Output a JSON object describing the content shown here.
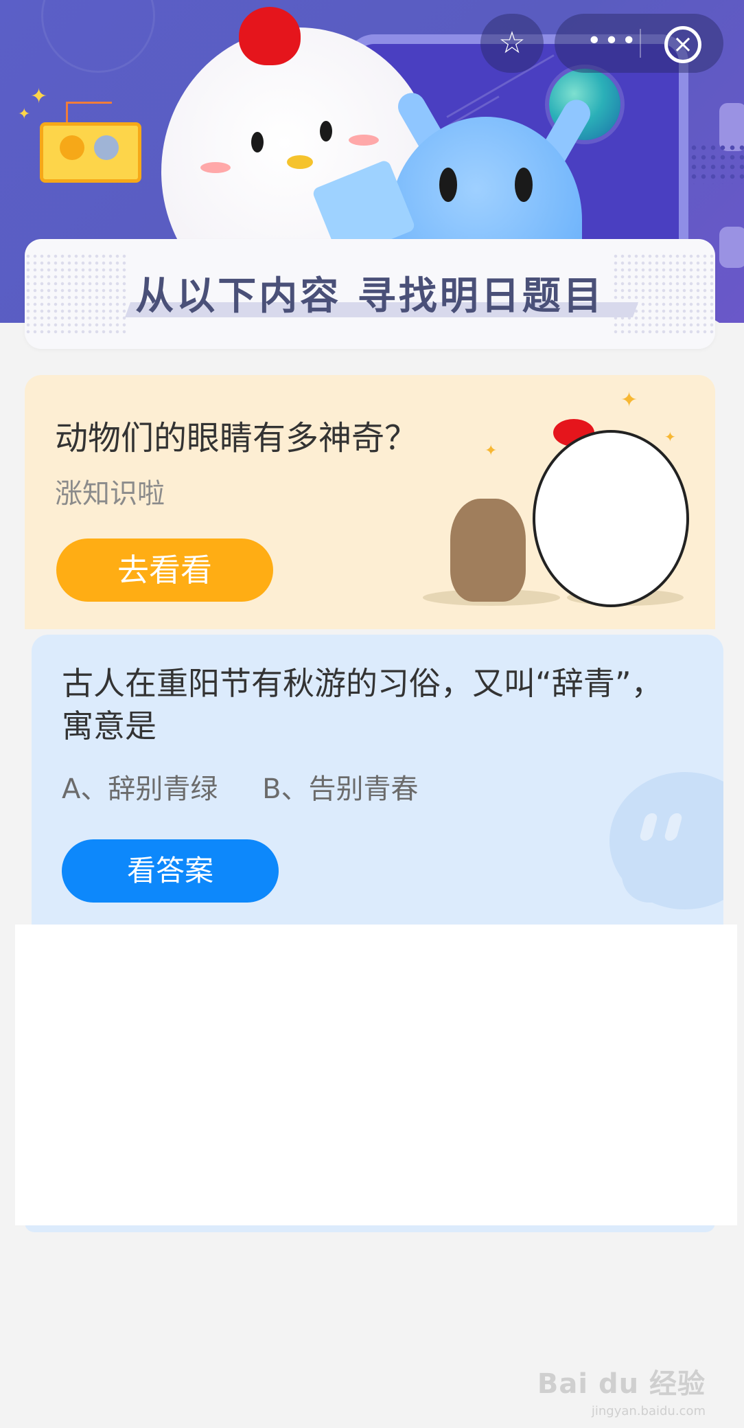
{
  "header": {
    "banner_title": "从以下内容  寻找明日题目",
    "icons": [
      "star-icon",
      "more-icon",
      "close-icon"
    ]
  },
  "article_card": {
    "title": "动物们的眼睛有多神奇？",
    "subtitle": "涨知识啦",
    "button_label": "去看看"
  },
  "quiz_card": {
    "question": "古人在重阳节有秋游的习俗，又叫“辞青”，寓意是",
    "options": [
      "A、辞别青绿",
      "B、告别青春"
    ],
    "button_label": "看答案"
  },
  "watermark": {
    "brand": "Bai du 经验",
    "url": "jingyan.baidu.com"
  },
  "colors": {
    "header_bg": "#5b5fc7",
    "orange_button": "#ffad14",
    "blue_button": "#0d88fb",
    "article_card_bg": "#fdeed3",
    "quiz_card_bg": "#dcebfc"
  }
}
